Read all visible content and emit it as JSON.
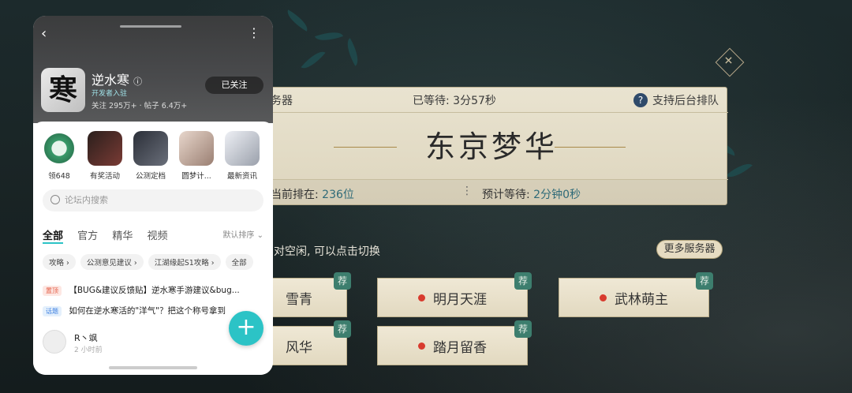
{
  "game": {
    "close_label": "✕",
    "queue_top": {
      "server_label": "务器",
      "waited": "已等待: 3分57秒",
      "help_icon": "?",
      "background_queue": "支持后台排队"
    },
    "server_name": "东京梦华",
    "position_label": "当前排在:",
    "position_value": "236位",
    "sep": "⋮",
    "wait_label": "预计等待:",
    "wait_value": "2分钟0秒",
    "hint": "对空闲, 可以点击切换",
    "more_servers": "更多服务器",
    "recommend": "荐",
    "servers": [
      {
        "name": "雪青"
      },
      {
        "name": "明月天涯"
      },
      {
        "name": "武林萌主"
      },
      {
        "name": "风华"
      },
      {
        "name": "踏月留香"
      }
    ]
  },
  "app": {
    "back_icon": "‹",
    "more_icon": "⋮",
    "game_icon_glyph": "寒",
    "name": "逆水寒",
    "info_icon": "ⓘ",
    "dev_badge": "开发者入驻",
    "stats": "关注 295万+ · 帖子 6.4万+",
    "follow": "已关注",
    "shortcuts": [
      {
        "label": "领648",
        "color": "#3a9a6a"
      },
      {
        "label": "有奖活动",
        "color": "#7a3b35"
      },
      {
        "label": "公测定档",
        "color": "#4a4f5a"
      },
      {
        "label": "圆梦计...",
        "color": "#b8a59a"
      },
      {
        "label": "最新资讯",
        "color": "#c7ccd6"
      }
    ],
    "search_placeholder": "论坛内搜索",
    "tabs": [
      "全部",
      "官方",
      "精华",
      "视频"
    ],
    "sort": "默认排序",
    "chips": [
      "攻略",
      "公测意见建议",
      "江湖缘起S1攻略",
      "全部"
    ],
    "posts": [
      {
        "tag": "置顶",
        "title": "【BUG&建议反馈贴】逆水寒手游建议&bug..."
      },
      {
        "tag": "话题",
        "title": "如何在逆水寒活的\"洋气\"？把这个称号拿到手！"
      }
    ],
    "user": {
      "name": "R丶飒",
      "time": "2 小时前"
    },
    "fab": "+"
  }
}
